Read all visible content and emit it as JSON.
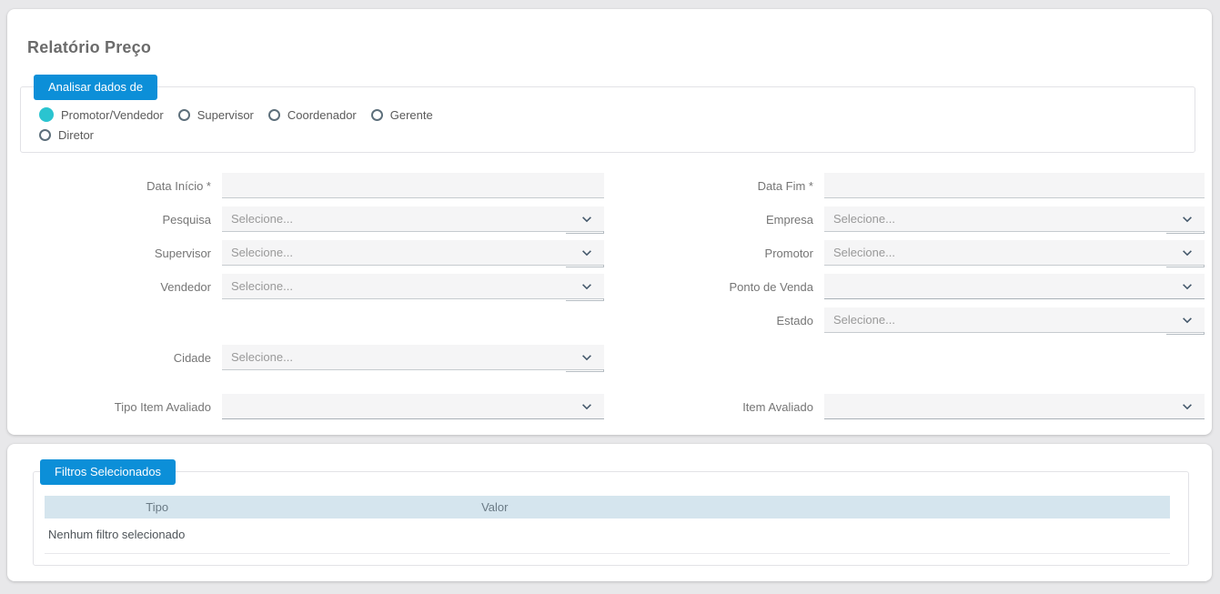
{
  "page": {
    "title": "Relatório Preço"
  },
  "analyze": {
    "legend": "Analisar dados de",
    "options": [
      {
        "id": "promotor-vendedor",
        "label": "Promotor/Vendedor",
        "selected": true
      },
      {
        "id": "supervisor",
        "label": "Supervisor",
        "selected": false
      },
      {
        "id": "coordenador",
        "label": "Coordenador",
        "selected": false
      },
      {
        "id": "gerente",
        "label": "Gerente",
        "selected": false
      },
      {
        "id": "diretor",
        "label": "Diretor",
        "selected": false
      }
    ]
  },
  "form": {
    "select_placeholder": "Selecione...",
    "rows": [
      {
        "left": {
          "id": "data-inicio",
          "label": "Data Início *",
          "type": "input",
          "value": ""
        },
        "right": {
          "id": "data-fim",
          "label": "Data Fim *",
          "type": "input",
          "value": ""
        }
      },
      {
        "left": {
          "id": "pesquisa",
          "label": "Pesquisa",
          "type": "select",
          "value": "Selecione..."
        },
        "right": {
          "id": "empresa",
          "label": "Empresa",
          "type": "select",
          "value": "Selecione..."
        }
      },
      {
        "left": {
          "id": "supervisor",
          "label": "Supervisor",
          "type": "select",
          "value": "Selecione..."
        },
        "right": {
          "id": "promotor",
          "label": "Promotor",
          "type": "select",
          "value": "Selecione..."
        }
      },
      {
        "left": {
          "id": "vendedor",
          "label": "Vendedor",
          "type": "select",
          "value": "Selecione..."
        },
        "right": {
          "id": "ponto-de-venda",
          "label": "Ponto de Venda",
          "type": "select-empty",
          "value": ""
        }
      },
      {
        "left": null,
        "right": {
          "id": "estado",
          "label": "Estado",
          "type": "select",
          "value": "Selecione..."
        }
      },
      {
        "left": {
          "id": "cidade",
          "label": "Cidade",
          "type": "select",
          "value": "Selecione..."
        },
        "right": null,
        "extra_gap": 4
      },
      {
        "left": {
          "id": "tipo-item-avaliado",
          "label": "Tipo Item Avaliado",
          "type": "select-empty",
          "value": ""
        },
        "right": {
          "id": "item-avaliado",
          "label": "Item Avaliado",
          "type": "select-empty",
          "value": ""
        },
        "extra_gap": 17
      }
    ]
  },
  "filters": {
    "legend": "Filtros Selecionados",
    "table": {
      "columns": [
        "Tipo",
        "Valor"
      ],
      "empty_message": "Nenhum filtro selecionado"
    }
  },
  "colors": {
    "accent_blue": "#0c8fd8",
    "radio_selected_teal": "#2ac4d0",
    "table_header_bg": "#d5e5ee",
    "field_bg": "#f5f5f6"
  }
}
